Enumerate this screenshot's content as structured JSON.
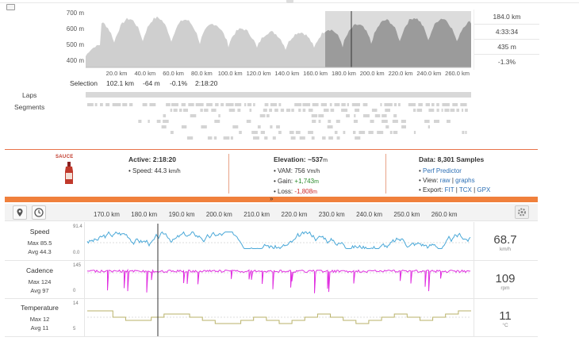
{
  "elevation": {
    "y_ticks": [
      "700 m",
      "600 m",
      "500 m",
      "400 m"
    ],
    "x_ticks": [
      "20.0 km",
      "40.0 km",
      "60.0 km",
      "80.0 km",
      "100.0 km",
      "120.0 km",
      "140.0 km",
      "160.0 km",
      "180.0 km",
      "200.0 km",
      "220.0 km",
      "240.0 km",
      "260.0 km"
    ],
    "stats": [
      "184.0 km",
      "4:33:34",
      "435 m",
      "-1.3%"
    ]
  },
  "selection": {
    "label": "Selection",
    "distance": "102.1 km",
    "elev": "-64 m",
    "grade": "-0.1%",
    "time": "2:18:20"
  },
  "rows": {
    "laps": "Laps",
    "segments": "Segments"
  },
  "info": {
    "brand": "SAUCE",
    "active_label": "Active:",
    "active_value": "2:18:20",
    "speed_label": "Speed:",
    "speed_value": "44.3",
    "speed_unit": "km/h",
    "elevation_label": "Elevation:",
    "elevation_value": "~537",
    "elevation_unit": "m",
    "vam_label": "VAM:",
    "vam_value": "756",
    "vam_unit": "Vm/h",
    "gain_label": "Gain:",
    "gain_value": "+1,743",
    "gain_unit": "m",
    "loss_label": "Loss:",
    "loss_value": "-1,808",
    "loss_unit": "m",
    "data_label": "Data:",
    "data_value": "8,301 Samples",
    "perf_link": "Perf Predictor",
    "view_label": "View:",
    "view_raw": "raw",
    "view_sep": "|",
    "view_graphs": "graphs",
    "export_label": "Export:",
    "export_fit": "FIT",
    "export_tcx": "TCX",
    "export_gpx": "GPX"
  },
  "toolbar": {
    "chevron": "»",
    "x_ticks": [
      "170.0 km",
      "180.0 km",
      "190.0 km",
      "200.0 km",
      "210.0 km",
      "220.0 km",
      "230.0 km",
      "240.0 km",
      "250.0 km",
      "260.0 km"
    ]
  },
  "channels": [
    {
      "name": "Speed",
      "max": "Max 85.5",
      "avg": "Avg 44.3",
      "top": "91.4",
      "bottom": "0.0",
      "value": "68.7",
      "unit": "km/h",
      "color": "#4aa8d8"
    },
    {
      "name": "Cadence",
      "max": "Max 124",
      "avg": "Avg 97",
      "top": "145",
      "bottom": "0",
      "value": "109",
      "unit": "rpm",
      "color": "#e030e0"
    },
    {
      "name": "Temperature",
      "max": "Max 12",
      "avg": "Avg 11",
      "top": "14",
      "bottom": "5",
      "value": "11",
      "unit": "°C",
      "color": "#b9b26a"
    }
  ],
  "colors": {
    "accent": "#f0803c",
    "elevation_fill": "#cfcfcf",
    "selection_fill": "#9b9b9b"
  }
}
